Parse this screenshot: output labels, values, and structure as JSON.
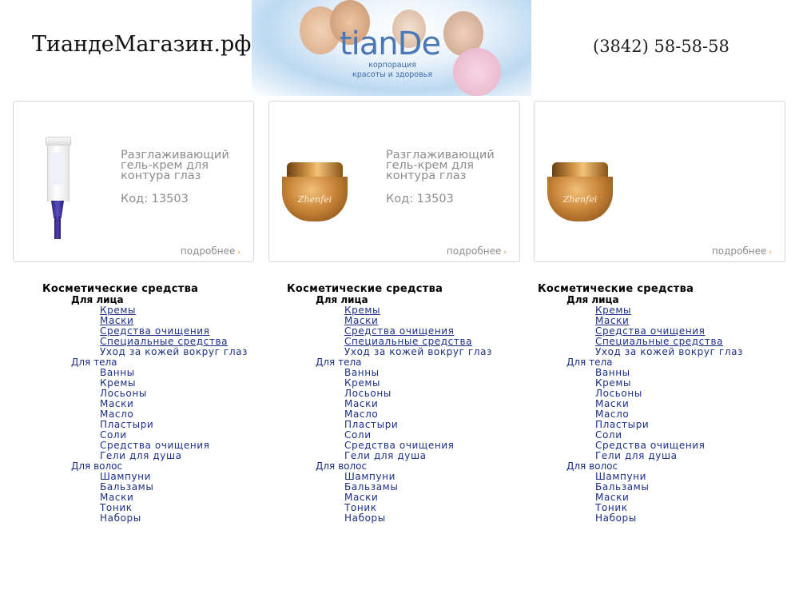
{
  "header": {
    "site_title": "ТиандеМагазин.рф",
    "phone": "(3842) 58-58-58",
    "logo": "tianDe",
    "logo_sub_line1": "корпорация",
    "logo_sub_line2": "красоты и здоровья"
  },
  "products": [
    {
      "name_line1": "Разглаживающий",
      "name_line2": "гель-крем для",
      "name_line3": "контура глаз",
      "code": "Код: 13503",
      "more": "подробнее",
      "image": "tube-icon"
    },
    {
      "name_line1": "Разглаживающий",
      "name_line2": "гель-крем для",
      "name_line3": "контура глаз",
      "code": "Код: 13503",
      "more": "подробнее",
      "image": "jar-icon",
      "jar_brand": "Zhenfei"
    },
    {
      "more": "подробнее",
      "image": "jar-icon",
      "jar_brand": "Zhenfei"
    }
  ],
  "menu": {
    "title": "Косметические средства",
    "face": "Для лица",
    "face_items": [
      "Кремы",
      "Маски",
      "Средства очищения",
      "Специальные средства",
      "Уход за кожей вокруг глаз"
    ],
    "body": "Для тела",
    "body_items": [
      "Ванны",
      "Кремы",
      "Лосьоны",
      "Маски",
      "Масло",
      "Пластыри",
      "Соли",
      "Средства очищения",
      "Гели для душа"
    ],
    "hair": "Для волос",
    "hair_items": [
      "Шампуни",
      "Бальзамы",
      "Маски",
      "Тоник",
      "Наборы"
    ]
  },
  "colors": {
    "link": "#1b2f86",
    "muted_text": "#8c8c8c",
    "arrow": "#f08a00",
    "logo": "#4a78b6"
  }
}
